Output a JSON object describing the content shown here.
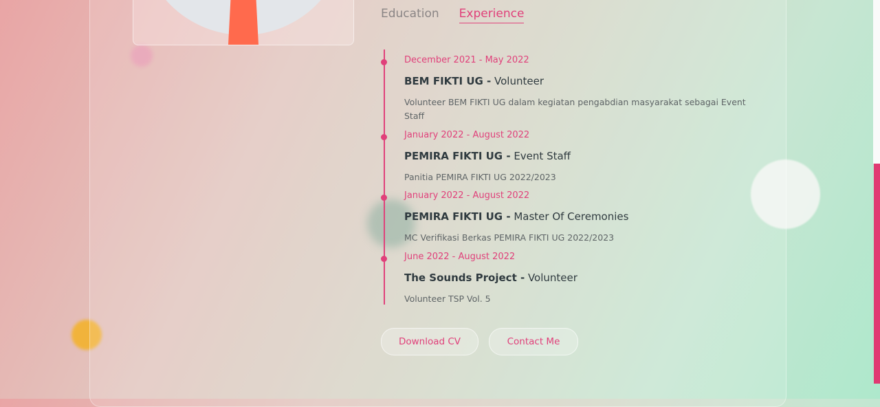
{
  "tabs": [
    {
      "label": "Education",
      "active": false
    },
    {
      "label": "Experience",
      "active": true
    }
  ],
  "experience": [
    {
      "date": "December 2021 - May 2022",
      "org": "BEM FIKTI UG -",
      "role": " Volunteer",
      "desc": "Volunteer BEM FIKTI UG dalam kegiatan pengabdian masyarakat sebagai Event Staff"
    },
    {
      "date": "January 2022 - August 2022",
      "org": "PEMIRA FIKTI UG -",
      "role": " Event Staff",
      "desc": "Panitia PEMIRA FIKTI UG 2022/2023"
    },
    {
      "date": "January 2022 - August 2022",
      "org": "PEMIRA FIKTI UG -",
      "role": " Master Of Ceremonies",
      "desc": "MC Verifikasi Berkas PEMIRA FIKTI UG 2022/2023"
    },
    {
      "date": "June 2022 - August 2022",
      "org": "The Sounds Project -",
      "role": " Volunteer",
      "desc": "Volunteer TSP Vol. 5"
    }
  ],
  "buttons": {
    "download_cv": "Download CV",
    "contact_me": "Contact Me"
  },
  "colors": {
    "accent": "#e0407a",
    "text": "#2f3a3f"
  }
}
